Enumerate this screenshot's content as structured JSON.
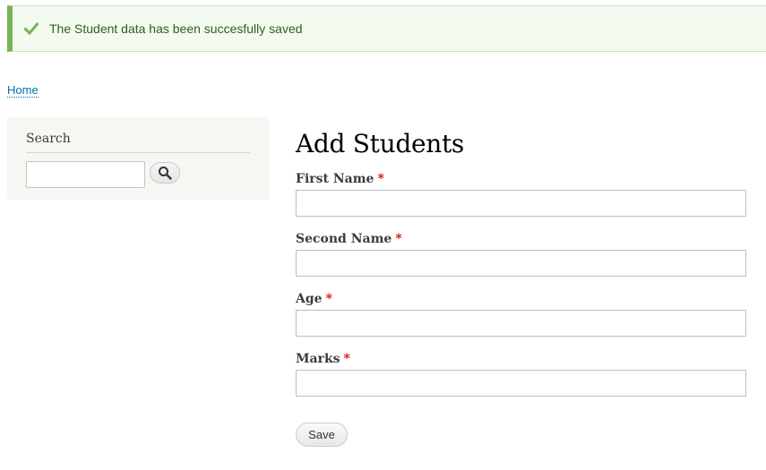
{
  "status": {
    "message": "The Student data has been succesfully saved",
    "icon": "check-icon",
    "accent_color": "#77b259"
  },
  "breadcrumb": {
    "home_label": "Home"
  },
  "sidebar": {
    "search_title": "Search",
    "search_value": "",
    "search_icon": "magnifier-icon"
  },
  "form": {
    "title": "Add Students",
    "required_marker": "*",
    "fields": [
      {
        "label": "First Name",
        "value": ""
      },
      {
        "label": "Second Name",
        "value": ""
      },
      {
        "label": "Age",
        "value": ""
      },
      {
        "label": "Marks",
        "value": ""
      }
    ],
    "save_label": "Save"
  }
}
